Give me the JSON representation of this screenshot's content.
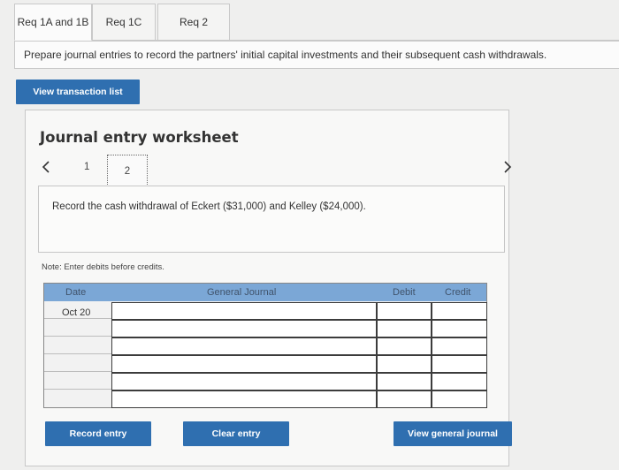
{
  "tabs": [
    {
      "label": "Req 1A and 1B"
    },
    {
      "label": "Req 1C"
    },
    {
      "label": "Req 2"
    }
  ],
  "instruction": "Prepare journal entries to record the partners' initial capital investments and their subsequent cash withdrawals.",
  "view_transaction_list": "View transaction list",
  "worksheet": {
    "title": "Journal entry worksheet",
    "pages": [
      "1",
      "2"
    ],
    "task": "Record the cash withdrawal of Eckert ($31,000) and Kelley ($24,000).",
    "note": "Note: Enter debits before credits."
  },
  "journal": {
    "headers": {
      "date": "Date",
      "general_journal": "General Journal",
      "debit": "Debit",
      "credit": "Credit"
    },
    "first_date": "Oct 20"
  },
  "buttons": {
    "record_entry": "Record entry",
    "clear_entry": "Clear entry",
    "view_general_journal": "View general journal"
  },
  "colors": {
    "button_blue": "#2f6fb0",
    "header_blue": "#7ba7d6"
  }
}
